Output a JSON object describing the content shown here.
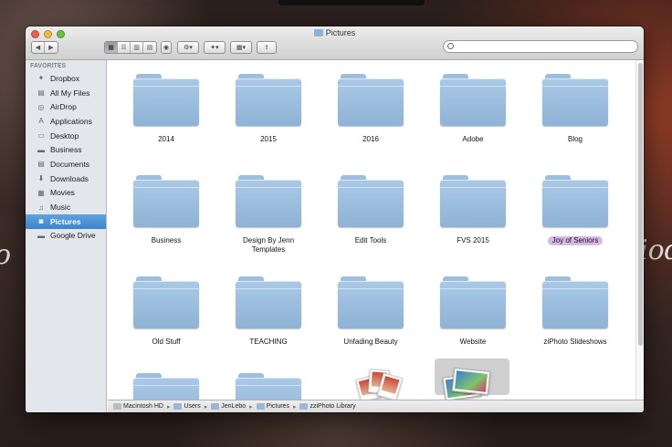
{
  "window": {
    "title": "Pictures"
  },
  "toolbar": {
    "nav": {
      "back": "◀",
      "forward": "▶"
    },
    "view_modes": [
      "icon-view",
      "list-view",
      "column-view",
      "coverflow-view"
    ],
    "action_icon": "gear-icon",
    "dropbox_icon": "dropbox-icon",
    "arrange_icon": "arrange-icon",
    "share_icon": "share-icon",
    "search": {
      "value": "",
      "placeholder": ""
    }
  },
  "sidebar": {
    "heading": "FAVORITES",
    "items": [
      {
        "label": "Dropbox",
        "icon": "dropbox-icon"
      },
      {
        "label": "All My Files",
        "icon": "all-files-icon"
      },
      {
        "label": "AirDrop",
        "icon": "airdrop-icon"
      },
      {
        "label": "Applications",
        "icon": "applications-icon"
      },
      {
        "label": "Desktop",
        "icon": "desktop-icon"
      },
      {
        "label": "Business",
        "icon": "folder-icon"
      },
      {
        "label": "Documents",
        "icon": "documents-icon"
      },
      {
        "label": "Downloads",
        "icon": "downloads-icon"
      },
      {
        "label": "Movies",
        "icon": "movies-icon"
      },
      {
        "label": "Music",
        "icon": "music-icon"
      },
      {
        "label": "Pictures",
        "icon": "camera-icon",
        "selected": true
      },
      {
        "label": "Google Drive",
        "icon": "folder-icon"
      }
    ]
  },
  "files": [
    {
      "name": "2014"
    },
    {
      "name": "2015"
    },
    {
      "name": "2016"
    },
    {
      "name": "Adobe"
    },
    {
      "name": "Blog"
    },
    {
      "name": "Business"
    },
    {
      "name": "Design By Jenn\nTemplates"
    },
    {
      "name": "Edit Tools"
    },
    {
      "name": "FVS 2015"
    },
    {
      "name": "Joy of Seniors",
      "tag_color": "#d8b8e8"
    },
    {
      "name": "Old Stuff"
    },
    {
      "name": "TEACHING"
    },
    {
      "name": "Unfading Beauty"
    },
    {
      "name": "Website"
    },
    {
      "name": "ziPhoto Slideshows"
    }
  ],
  "path": [
    "Macintosh HD",
    "Users",
    "JenLebo",
    "Pictures",
    "zziPhoto Library"
  ]
}
